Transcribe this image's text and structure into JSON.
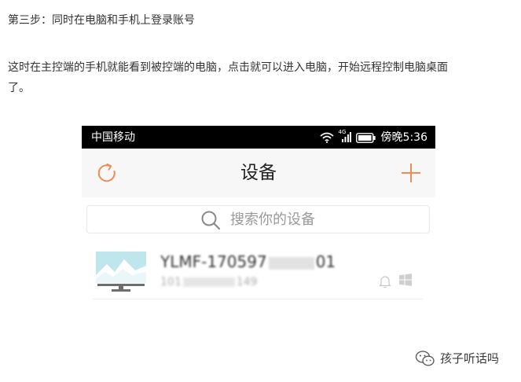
{
  "article": {
    "step_heading": "第三步：同时在电脑和手机上登录账号",
    "paragraph_line1": "这时在主控端的手机就能看到被控端的电脑，点击就可以进入电脑，开始远程控制电脑桌面",
    "paragraph_line2": "了。"
  },
  "phone": {
    "status_bar": {
      "carrier": "中国移动",
      "network": "4G",
      "time": "傍晚5:36"
    },
    "title_bar": {
      "title": "设备",
      "left_icon": "refresh-icon",
      "right_icon": "plus-icon"
    },
    "search": {
      "placeholder": "搜索你的设备"
    },
    "device": {
      "name": "YLMF-170597",
      "name_suffix": "01",
      "sub_id": "101",
      "sub_suffix": "149",
      "icons": [
        "bell-icon",
        "windows-icon"
      ]
    }
  },
  "watermark": {
    "text": "孩子听话吗"
  },
  "colors": {
    "accent": "#f08b55",
    "status_bar_bg": "#000000",
    "title_bar_bg": "#f7f7f7",
    "text": "#333333"
  }
}
